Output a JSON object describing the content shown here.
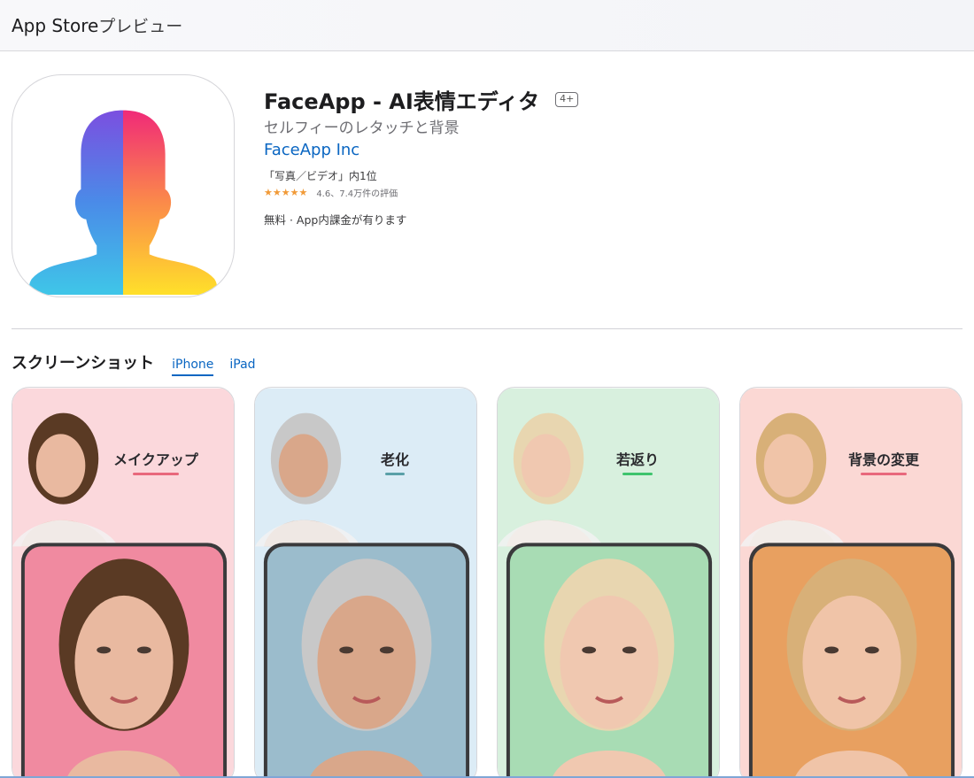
{
  "header": {
    "brand": "App Store",
    "brand_sub": "プレビュー"
  },
  "app": {
    "title": "FaceApp - AI表情エディタ",
    "age_rating": "4+",
    "subtitle": "セルフィーのレタッチと背景",
    "developer": "FaceApp Inc",
    "rank": "「写真／ビデオ」内1位",
    "stars": "★★★★★",
    "rating_value": 4.6,
    "rating_text": "4.6、7.4万件の評価",
    "price": "無料 · App内課金が有ります",
    "icon": "faceapp-logo-icon"
  },
  "screenshots": {
    "title": "スクリーンショット",
    "tabs": [
      {
        "label": "iPhone",
        "active": true
      },
      {
        "label": "iPad",
        "active": false
      }
    ],
    "items": [
      {
        "label": "メイクアップ",
        "underline_color": "#e8687c",
        "bg": "#fbd8dc",
        "frame_bg": "#f08aa0",
        "hair": "#5a3a24",
        "skin": "#e9b9a0"
      },
      {
        "label": "老化",
        "underline_color": "#5aa0a8",
        "bg": "#dcecf6",
        "frame_bg": "#9bbccc",
        "hair": "#c8c8c8",
        "skin": "#d9a78a"
      },
      {
        "label": "若返り",
        "underline_color": "#3ec46d",
        "bg": "#d8f0de",
        "frame_bg": "#a8dcb4",
        "hair": "#e8d6b0",
        "skin": "#f0c8b0"
      },
      {
        "label": "背景の変更",
        "underline_color": "#e8687c",
        "bg": "#fbd8d4",
        "frame_bg": "#e8a060",
        "hair": "#d8b078",
        "skin": "#f0c4a8"
      }
    ]
  }
}
